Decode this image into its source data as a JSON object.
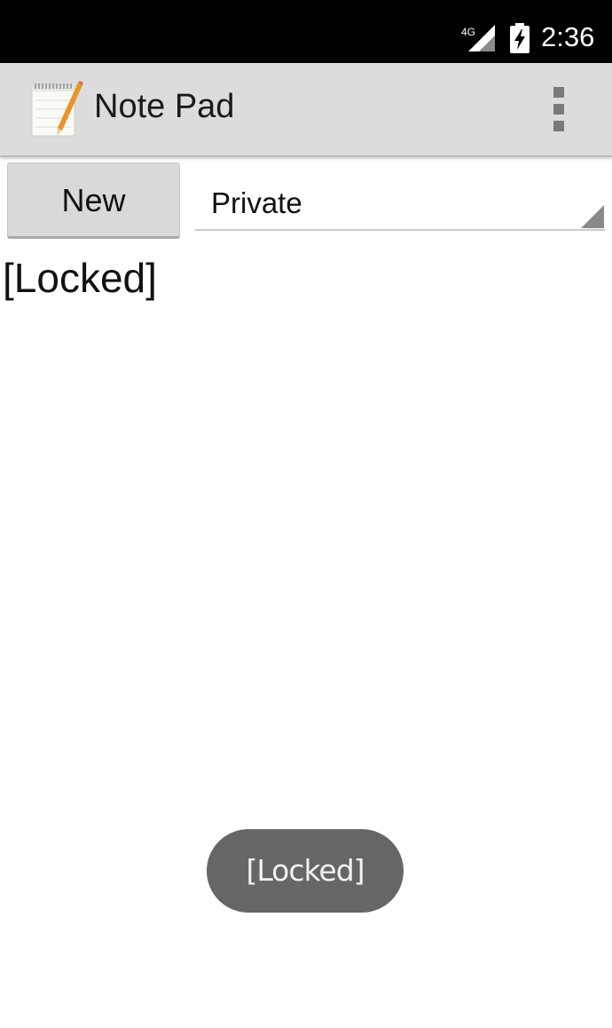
{
  "status_bar": {
    "network_label": "4G",
    "time": "2:36",
    "icons": [
      "signal-4g-icon",
      "battery-charging-icon"
    ]
  },
  "action_bar": {
    "title": "Note Pad",
    "icons": [
      "notepad-app-icon",
      "overflow-menu-icon"
    ]
  },
  "toolbar": {
    "new_label": "New",
    "folder_selected": "Private"
  },
  "notes": [
    {
      "title": "[Locked]"
    }
  ],
  "toast": {
    "message": "[Locked]"
  },
  "colors": {
    "status_bar": "#000000",
    "action_bar": "#dcdcdc",
    "button": "#d9d9d9",
    "toast": "#666666"
  }
}
